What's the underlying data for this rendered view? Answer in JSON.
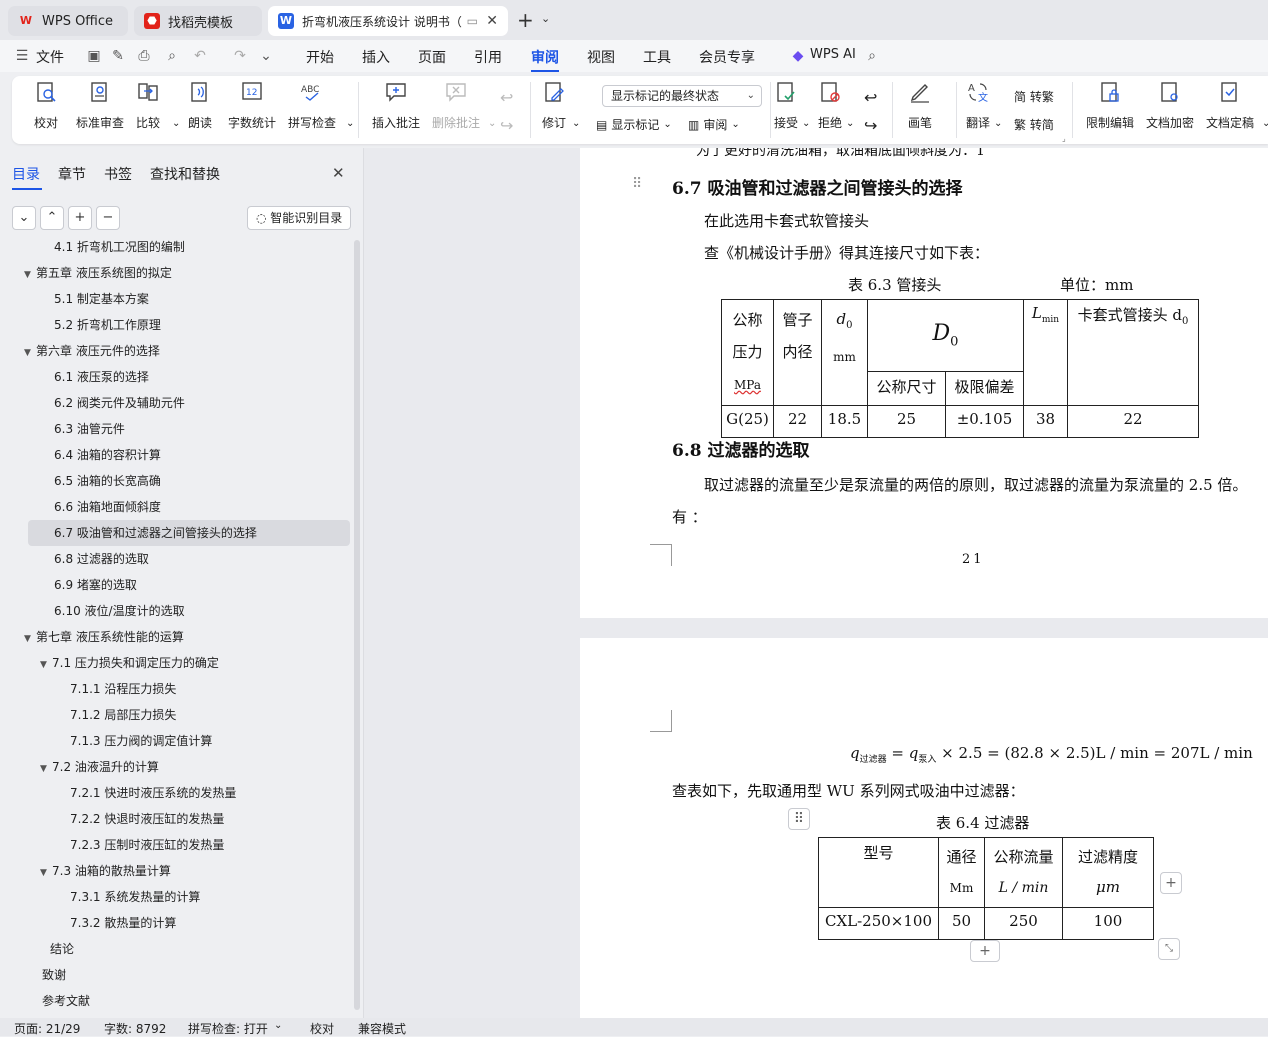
{
  "tabs": [
    {
      "label": "WPS Office"
    },
    {
      "label": "找稻壳模板"
    },
    {
      "label": "折弯机液压系统设计 说明书（"
    }
  ],
  "menu": {
    "file": "文件",
    "items": [
      "开始",
      "插入",
      "页面",
      "引用",
      "审阅",
      "视图",
      "工具",
      "会员专享"
    ],
    "ai": "WPS AI"
  },
  "ribbon": {
    "proofread": "校对",
    "std_review": "标准审查",
    "compare": "比较",
    "read": "朗读",
    "word_count": "字数统计",
    "spell_check": "拼写检查",
    "insert_comment": "插入批注",
    "delete_comment": "删除批注",
    "revise": "修订",
    "display_state": "显示标记的最终状态",
    "show_marks": "显示标记",
    "review": "审阅",
    "accept": "接受",
    "reject": "拒绝",
    "pen": "画笔",
    "translate": "翻译",
    "to_trad": "简 转繁",
    "to_simp": "繁 转简",
    "restrict": "限制编辑",
    "encrypt": "文档加密",
    "finalize": "文档定稿"
  },
  "sidebar": {
    "tabs": [
      "目录",
      "章节",
      "书签",
      "查找和替换"
    ],
    "smart": "智能识别目录",
    "toc": [
      {
        "label": "4.1 折弯机工况图的编制",
        "indent": 2
      },
      {
        "label": "第五章  液压系统图的拟定",
        "indent": 1,
        "arrow": true
      },
      {
        "label": "5.1  制定基本方案",
        "indent": 2
      },
      {
        "label": "5.2 折弯机工作原理",
        "indent": 2
      },
      {
        "label": "第六章  液压元件的选择",
        "indent": 1,
        "arrow": true
      },
      {
        "label": "6.1  液压泵的选择",
        "indent": 2
      },
      {
        "label": "6.2    阀类元件及辅助元件",
        "indent": 2
      },
      {
        "label": "6.3  油管元件",
        "indent": 2
      },
      {
        "label": "6.4 油箱的容积计算",
        "indent": 2
      },
      {
        "label": "6.5 油箱的长宽高确",
        "indent": 2
      },
      {
        "label": "6.6 油箱地面倾斜度",
        "indent": 2
      },
      {
        "label": "6.7 吸油管和过滤器之间管接头的选择",
        "indent": 2,
        "selected": true
      },
      {
        "label": "6.8 过滤器的选取",
        "indent": 2
      },
      {
        "label": "6.9 堵塞的选取",
        "indent": 2
      },
      {
        "label": "6.10 液位/温度计的选取",
        "indent": 2
      },
      {
        "label": "第七章    液压系统性能的运算",
        "indent": 1,
        "arrow": true
      },
      {
        "label": "7.1    压力损失和调定压力的确定",
        "indent": 2,
        "arrow": true
      },
      {
        "label": "7.1.1 沿程压力损失",
        "indent": 3
      },
      {
        "label": "7.1.2 局部压力损失",
        "indent": 3
      },
      {
        "label": "7.1.3 压力阀的调定值计算",
        "indent": 3
      },
      {
        "label": "7.2  油液温升的计算",
        "indent": 2,
        "arrow": true
      },
      {
        "label": "7.2.1 快进时液压系统的发热量",
        "indent": 3
      },
      {
        "label": "7.2.2  快退时液压缸的发热量",
        "indent": 3
      },
      {
        "label": "7.2.3 压制时液压缸的发热量",
        "indent": 3
      },
      {
        "label": "7.3 油箱的散热量计算",
        "indent": 2,
        "arrow": true
      },
      {
        "label": "7.3.1 系统发热量的计算",
        "indent": 3
      },
      {
        "label": "7.3.2  散热量的计算",
        "indent": 3
      },
      {
        "label": "结论",
        "indent": 0.5
      },
      {
        "label": "致谢",
        "indent": 0
      },
      {
        "label": "参考文献",
        "indent": 0
      }
    ]
  },
  "doc": {
    "top_cut": "为了更好的清洗油箱，取油箱底面倾斜度为：1",
    "h67": "6.7 吸油管和过滤器之间管接头的选择",
    "p1": "在此选用卡套式软管接头",
    "p2": "查《机械设计手册》得其连接尺寸如下表：",
    "t63_caption": "表 6.3   管接头",
    "t63_unit": "单位：mm",
    "t63": {
      "c1": "公称",
      "c1b": "压力",
      "c1c": "MPa",
      "c2": "管子",
      "c2b": "内径",
      "c3": "d",
      "c3s": "0",
      "c3b": "mm",
      "c4": "D",
      "c4s": "0",
      "c4a": "公称尺寸",
      "c4b": "极限偏差",
      "c5": "L",
      "c5s": "min",
      "c6": "卡套式管接头 d",
      "c6s": "0",
      "row": [
        "G(25)",
        "22",
        "18.5",
        "25",
        "±0.105",
        "38",
        "22"
      ]
    },
    "h68": "6.8 过滤器的选取",
    "p3": "取过滤器的流量至少是泵流量的两倍的原则，取过滤器的流量为泵流量的 2.5 倍。",
    "p4": "有 ：",
    "page_no": "21",
    "formula_q1": "q",
    "formula_s1": "过滤器",
    "formula_q2": "q",
    "formula_s2": "泵入",
    "formula_rest": "× 2.5 = (82.8 × 2.5)L / min  = 207L / min",
    "p5": "查表如下，先取通用型 WU 系列网式吸油中过滤器：",
    "t64_caption": "表 6.4 过滤器",
    "t64": {
      "h1": "型号",
      "h2": "通径",
      "h2b": "Mm",
      "h3": "公称流量",
      "h3b": "L / min",
      "h4": "过滤精度",
      "h4b": "μm",
      "row": [
        "CXL-250×100",
        "50",
        "250",
        "100"
      ]
    }
  },
  "status": {
    "page": "页面: 21/29",
    "words": "字数: 8792",
    "spell": "拼写检查: 打开",
    "proof": "校对",
    "compat": "兼容模式"
  }
}
